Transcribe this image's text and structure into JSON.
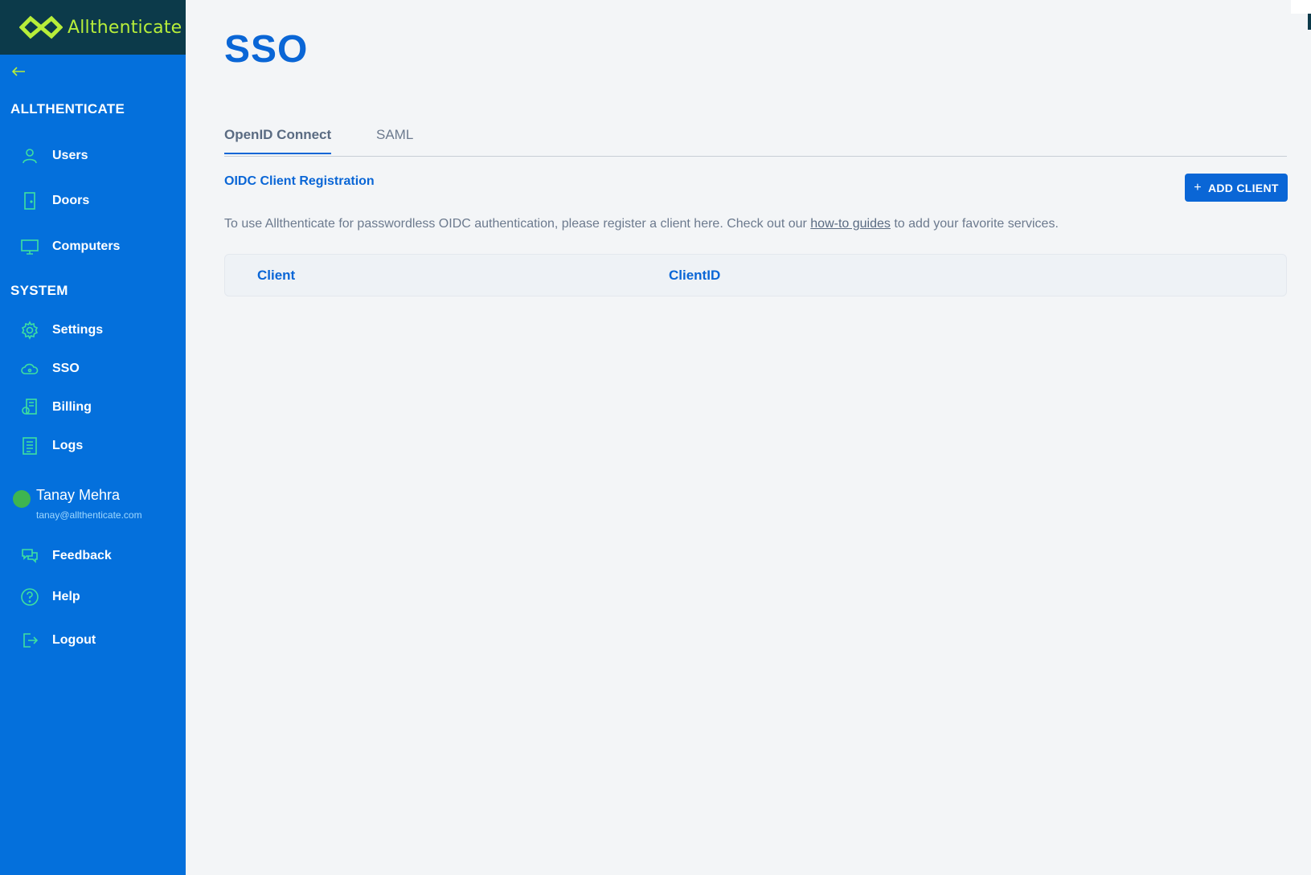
{
  "brand": {
    "name": "Allthenticate"
  },
  "sidebar": {
    "org_heading": "ALLTHENTICATE",
    "org_items": [
      {
        "label": "Users",
        "icon": "user-icon"
      },
      {
        "label": "Doors",
        "icon": "door-icon"
      },
      {
        "label": "Computers",
        "icon": "monitor-icon"
      }
    ],
    "system_heading": "SYSTEM",
    "system_items": [
      {
        "label": "Settings",
        "icon": "gear-icon"
      },
      {
        "label": "SSO",
        "icon": "cloud-icon"
      },
      {
        "label": "Billing",
        "icon": "billing-icon"
      },
      {
        "label": "Logs",
        "icon": "logs-icon"
      }
    ],
    "user": {
      "name": "Tanay Mehra",
      "email": "tanay@allthenticate.com"
    },
    "bottom_items": [
      {
        "label": "Feedback",
        "icon": "chat-icon"
      },
      {
        "label": "Help",
        "icon": "help-icon"
      },
      {
        "label": "Logout",
        "icon": "logout-icon"
      }
    ]
  },
  "main": {
    "title": "SSO",
    "tabs": [
      {
        "label": "OpenID Connect",
        "active": true
      },
      {
        "label": "SAML",
        "active": false
      }
    ],
    "section_title": "OIDC Client Registration",
    "add_button": "ADD CLIENT",
    "description_before": "To use Allthenticate for passwordless OIDC authentication, please register a client here. Check out our ",
    "description_link": "how-to guides",
    "description_after": " to add your favorite services.",
    "table": {
      "columns": [
        "Client",
        "ClientID"
      ]
    }
  },
  "colors": {
    "sidebar": "#0470dc",
    "brand_bar": "#0c3a4a",
    "brand_text": "#b7ee3a",
    "icon_accent": "#3ee0a0",
    "primary": "#0a66d6",
    "background": "#f3f5f7"
  }
}
